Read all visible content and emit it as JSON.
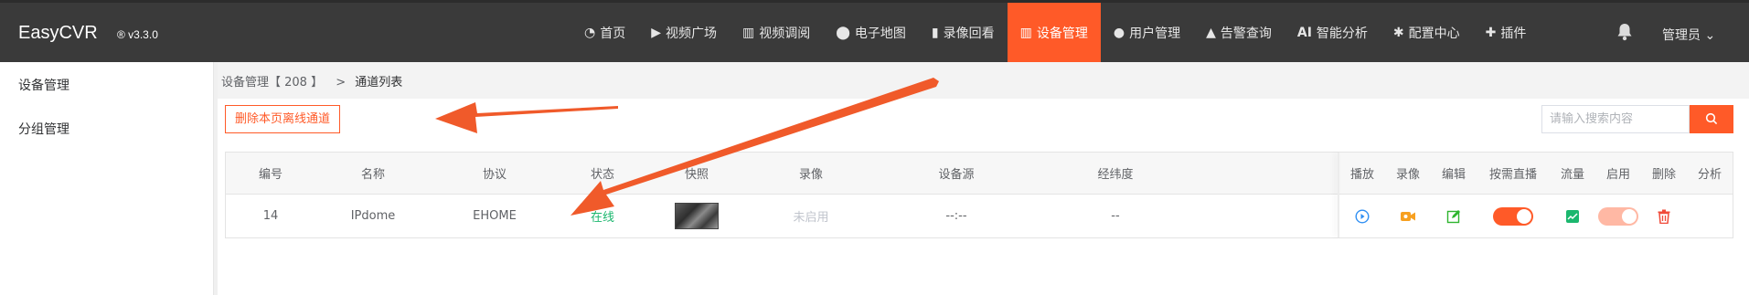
{
  "header": {
    "brand": "EasyCVR",
    "version": "® v3.3.0",
    "nav": [
      {
        "icon": "dashboard-icon",
        "glyph": "◔",
        "label": "首页"
      },
      {
        "icon": "play-circle-icon",
        "glyph": "▶",
        "label": "视频广场"
      },
      {
        "icon": "layout-icon",
        "glyph": "▥",
        "label": "视频调阅"
      },
      {
        "icon": "map-pin-icon",
        "glyph": "⬤",
        "label": "电子地图"
      },
      {
        "icon": "video-camera-icon",
        "glyph": "▮",
        "label": "录像回看"
      },
      {
        "icon": "device-icon",
        "glyph": "▥",
        "label": "设备管理"
      },
      {
        "icon": "user-icon",
        "glyph": "●",
        "label": "用户管理"
      },
      {
        "icon": "alarm-icon",
        "glyph": "▲",
        "label": "告警查询"
      },
      {
        "icon": "ai-icon",
        "glyph": "AI",
        "label": "智能分析"
      },
      {
        "icon": "gear-icon",
        "glyph": "✱",
        "label": "配置中心"
      },
      {
        "icon": "puzzle-icon",
        "glyph": "✚",
        "label": "插件"
      }
    ],
    "bell_glyph": "🔔",
    "user_label": "管理员 ⌄"
  },
  "sidebar": {
    "items": [
      {
        "label": "设备管理"
      },
      {
        "label": "分组管理"
      }
    ]
  },
  "breadcrumb": {
    "parent": "设备管理【 208 】",
    "separator": ">",
    "current": "通道列表"
  },
  "toolbar": {
    "delete_offline_label": "删除本页离线通道",
    "search_placeholder": "请输入搜索内容",
    "search_glyph": "⚲"
  },
  "table": {
    "columns": [
      "编号",
      "名称",
      "协议",
      "状态",
      "快照",
      "录像",
      "设备源",
      "经纬度",
      "播放",
      "录像",
      "编辑",
      "按需直播",
      "流量",
      "启用",
      "删除",
      "分析"
    ],
    "rows": [
      {
        "id": "14",
        "name": "IPdome",
        "protocol": "EHOME",
        "status": "在线",
        "record": "未启用",
        "source": "--:--",
        "latlng": "--",
        "on_demand": true,
        "enabled": true
      }
    ]
  },
  "colors": {
    "accent": "#ff5a28",
    "header_bg": "#3a3a3a",
    "online": "#1bb76e",
    "play_icon": "#2f8ff3",
    "record_icon": "#f7a020",
    "edit_icon": "#2fb52f",
    "flow_icon": "#1bb76e",
    "delete_icon": "#f04b3a"
  }
}
